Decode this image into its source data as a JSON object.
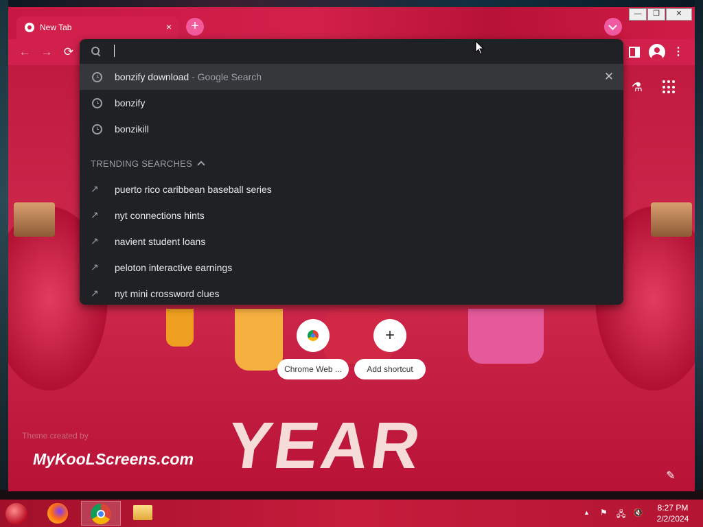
{
  "browser": {
    "tab": {
      "title": "New Tab",
      "close_glyph": "×"
    },
    "new_tab_glyph": "+",
    "tab_search_icon": "chevron-down-icon",
    "window_controls": {
      "minimize": "—",
      "maximize": "❐",
      "close": "✕"
    },
    "nav": {
      "back": "←",
      "forward": "→",
      "reload": "⟳",
      "menu": "⋮"
    },
    "colors": {
      "frame": "#d2204c",
      "omnibox_bg": "#202124",
      "selected_row": "#36373a"
    }
  },
  "omnibox": {
    "input_value": "",
    "recent": [
      {
        "text": "bonzify download",
        "suffix": " - Google Search",
        "selected": true
      },
      {
        "text": "bonzify"
      },
      {
        "text": "bonzikill"
      }
    ],
    "remove_glyph": "✕",
    "section_label": "TRENDING SEARCHES",
    "trending": [
      "puerto rico caribbean baseball series",
      "nyt connections hints",
      "navient student loans",
      "peloton interactive earnings",
      "nyt mini crossword clues"
    ],
    "trend_glyph": "↗"
  },
  "ntp": {
    "labs_glyph": "⚗",
    "shortcuts": [
      {
        "label": "Chrome Web ...",
        "icon": "chrome-web-store-icon"
      },
      {
        "label": "Add shortcut",
        "glyph": "+"
      }
    ],
    "theme_credit": "Theme created by",
    "theme_brand": "MyKooLScreens.com",
    "background_word": "YEAR",
    "customize_glyph": "✎"
  },
  "taskbar": {
    "apps": [
      "firefox",
      "chrome",
      "file-explorer"
    ],
    "tray": {
      "up": "▲",
      "flag": "⚑",
      "network": "🖧",
      "volume": "🔇"
    },
    "time": "8:27 PM",
    "date": "2/2/2024"
  }
}
